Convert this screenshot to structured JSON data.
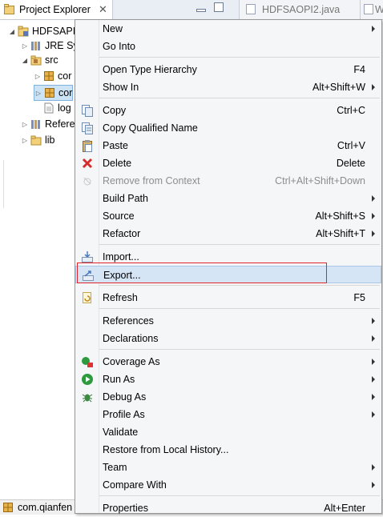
{
  "explorer": {
    "tab_title": "Project Explorer",
    "tab_close": "✕",
    "editor_tab1": "HDFSAOPI2.java",
    "editor_tab2": "W",
    "tree": [
      {
        "label": "HDFSAPI",
        "indent": 0,
        "twisty": "◢",
        "icon": "project-icon"
      },
      {
        "label": "JRE Sy",
        "indent": 1,
        "twisty": "▷",
        "icon": "library-icon"
      },
      {
        "label": "src",
        "indent": 1,
        "twisty": "◢",
        "icon": "source-folder-icon"
      },
      {
        "label": "cor",
        "indent": 2,
        "twisty": "▷",
        "icon": "package-icon"
      },
      {
        "label": "cor",
        "indent": 2,
        "twisty": "▷",
        "icon": "package-icon"
      },
      {
        "label": "log",
        "indent": 2,
        "twisty": "",
        "icon": "file-icon"
      },
      {
        "label": "Refere",
        "indent": 1,
        "twisty": "▷",
        "icon": "library-icon"
      },
      {
        "label": "lib",
        "indent": 1,
        "twisty": "▷",
        "icon": "folder-icon"
      }
    ],
    "bottom_label": "com.qianfen"
  },
  "menu": {
    "items": [
      {
        "label": "New",
        "accel": "",
        "submenu": true
      },
      {
        "label": "Go Into",
        "accel": "",
        "submenu": false
      },
      {
        "label": "Open Type Hierarchy",
        "accel": "F4",
        "submenu": false
      },
      {
        "label": "Show In",
        "accel": "Alt+Shift+W",
        "submenu": true
      },
      {
        "label": "Copy",
        "accel": "Ctrl+C",
        "submenu": false
      },
      {
        "label": "Copy Qualified Name",
        "accel": "",
        "submenu": false
      },
      {
        "label": "Paste",
        "accel": "Ctrl+V",
        "submenu": false
      },
      {
        "label": "Delete",
        "accel": "Delete",
        "submenu": false
      },
      {
        "label": "Remove from Context",
        "accel": "Ctrl+Alt+Shift+Down",
        "submenu": false
      },
      {
        "label": "Build Path",
        "accel": "",
        "submenu": true
      },
      {
        "label": "Source",
        "accel": "Alt+Shift+S",
        "submenu": true
      },
      {
        "label": "Refactor",
        "accel": "Alt+Shift+T",
        "submenu": true
      },
      {
        "label": "Import...",
        "accel": "",
        "submenu": false
      },
      {
        "label": "Export...",
        "accel": "",
        "submenu": false
      },
      {
        "label": "Refresh",
        "accel": "F5",
        "submenu": false
      },
      {
        "label": "References",
        "accel": "",
        "submenu": true
      },
      {
        "label": "Declarations",
        "accel": "",
        "submenu": true
      },
      {
        "label": "Coverage As",
        "accel": "",
        "submenu": true
      },
      {
        "label": "Run As",
        "accel": "",
        "submenu": true
      },
      {
        "label": "Debug As",
        "accel": "",
        "submenu": true
      },
      {
        "label": "Profile As",
        "accel": "",
        "submenu": true
      },
      {
        "label": "Validate",
        "accel": "",
        "submenu": false
      },
      {
        "label": "Restore from Local History...",
        "accel": "",
        "submenu": false
      },
      {
        "label": "Team",
        "accel": "",
        "submenu": true
      },
      {
        "label": "Compare With",
        "accel": "",
        "submenu": true
      },
      {
        "label": "Properties",
        "accel": "Alt+Enter",
        "submenu": false
      }
    ]
  },
  "colors": {
    "menu_bg": "#f5f6f7",
    "hover_bg": "#d5e5f5",
    "highlight_box": "#e0262a",
    "selection_bg": "#cde4f7"
  }
}
